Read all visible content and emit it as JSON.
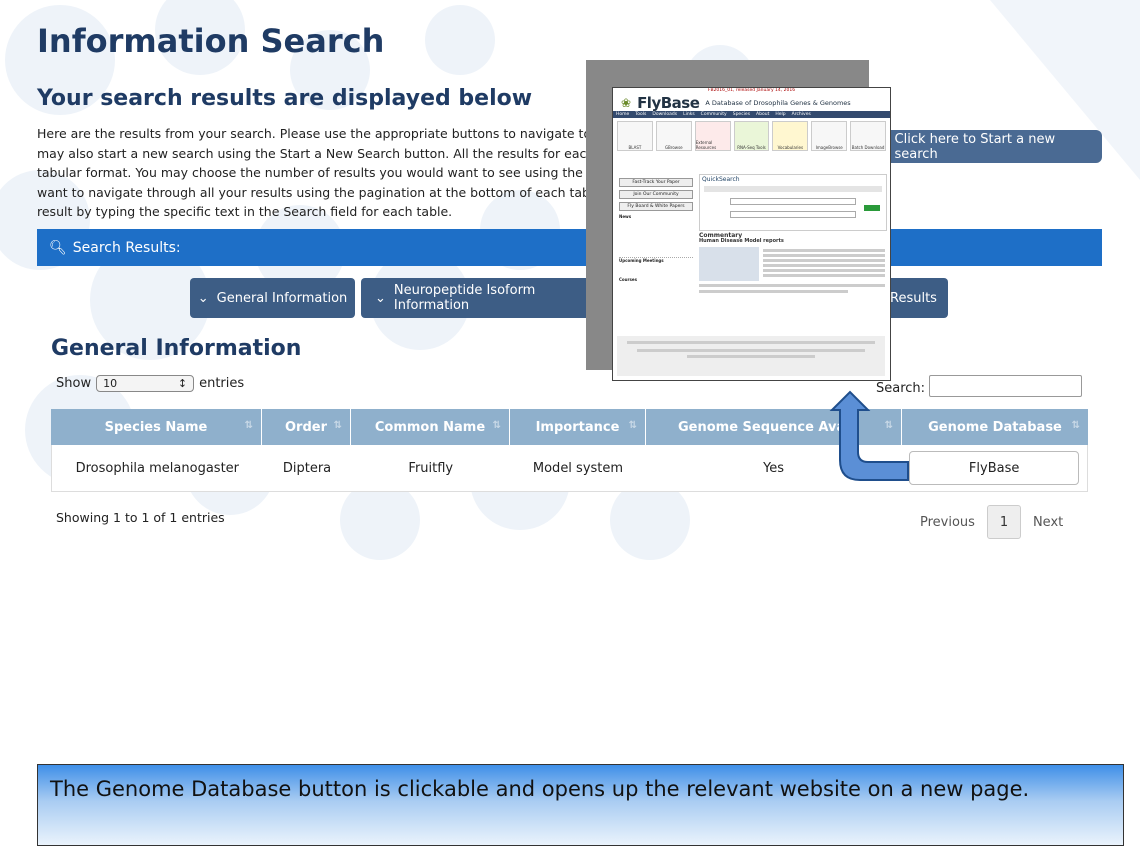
{
  "header": {
    "title": "Information Search",
    "subtitle": "Your search results are displayed below"
  },
  "intro_lines": [
    "Here are the results from your search. Please use the appropriate buttons to navigate to the relev",
    "may also start a new search using the Start a New Search button. All the results for each section ar",
    "tabular format. You may choose the number of results you would want to see using the entries dro",
    "want to navigate through all your results using the pagination at the bottom of each table. You ca",
    "result by typing the specific text in the Search field for each table."
  ],
  "new_search_button": "Click here to Start a new search",
  "results_bar": "Search Results:",
  "section_buttons": [
    "General Information",
    "Neuropeptide Isoform Information",
    "Results"
  ],
  "section": {
    "title": "General Information",
    "show_label": "Show",
    "entries_value": "10",
    "entries_label": "entries",
    "search_label": "Search:"
  },
  "table": {
    "headers": [
      "Species Name",
      "Order",
      "Common Name",
      "Importance",
      "Genome Sequence Avail",
      "Genome Database"
    ],
    "rows": [
      [
        "Drosophila melanogaster",
        "Diptera",
        "Fruitfly",
        "Model system",
        "Yes",
        "FlyBase"
      ]
    ]
  },
  "footer": {
    "showing": "Showing 1 to 1 of 1 entries",
    "previous": "Previous",
    "page": "1",
    "next": "Next"
  },
  "flybase_popup": {
    "top_notice": "FB2016_01, released January 14, 2016",
    "logo": "FlyBase",
    "tagline": "A Database of Drosophila Genes & Genomes",
    "nav": [
      "Home",
      "Tools",
      "Downloads",
      "Links",
      "Community",
      "Species",
      "About",
      "Help",
      "Archives"
    ],
    "tiles": [
      "BLAST",
      "GBrowse",
      "External Resources",
      "RNA-Seq Tools",
      "Vocabularies",
      "ImageBrowse",
      "Batch Download"
    ],
    "left_buttons": [
      "Fast-Track Your Paper",
      "Join Our Community",
      "Fly Board & White Papers"
    ],
    "news_label": "News",
    "upcoming_label": "Upcoming Meetings",
    "courses_label": "Courses",
    "quicksearch_label": "QuickSearch",
    "commentary_label": "Commentary",
    "commentary_title": "Human Disease Model reports"
  },
  "caption": "The Genome Database button is clickable and opens up the relevant website on a new page.",
  "colors": {
    "title": "#1f3b64",
    "bar": "#1e6fc7",
    "button": "#3d5d85",
    "table_header": "#8fb0cc"
  }
}
